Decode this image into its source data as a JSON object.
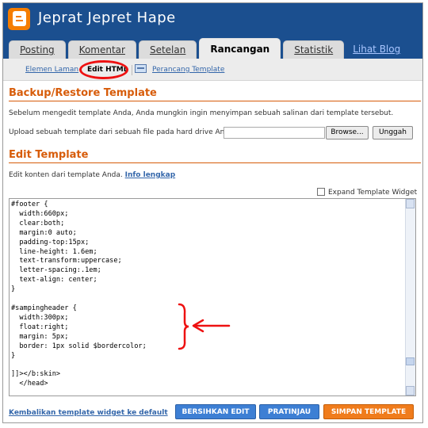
{
  "app": {
    "blog_title": "Jeprat Jepret Hape"
  },
  "tabs": [
    {
      "label": "Posting"
    },
    {
      "label": "Komentar"
    },
    {
      "label": "Setelan"
    },
    {
      "label": "Rancangan",
      "active": true
    },
    {
      "label": "Statistik"
    },
    {
      "label": "Lihat Blog"
    }
  ],
  "subnav": {
    "items": [
      {
        "label": "Elemen Laman"
      },
      {
        "label": "Edit HTML",
        "active": true
      },
      {
        "label": "Perancang Template"
      }
    ]
  },
  "backup": {
    "heading": "Backup/Restore Template",
    "description": "Sebelum mengedit template Anda, Anda mungkin ingin menyimpan sebuah salinan dari template tersebut.",
    "upload_label": "Upload sebuah template dari sebuah file pada hard drive Anda:",
    "upload_value": "",
    "browse_label": "Browse...",
    "upload_button": "Unggah"
  },
  "edit_template": {
    "heading": "Edit Template",
    "description": "Edit konten dari template Anda.",
    "info_link": "Info lengkap",
    "expand_label": "Expand Template Widget",
    "expand_checked": false,
    "code": "#footer {\n  width:660px;\n  clear:both;\n  margin:0 auto;\n  padding-top:15px;\n  line-height: 1.6em;\n  text-transform:uppercase;\n  letter-spacing:.1em;\n  text-align: center;\n}\n\n#sampingheader {\n  width:300px;\n  float:right;\n  margin: 5px;\n  border: 1px solid $bordercolor;\n}\n\n]]></b:skin>\n  </head>"
  },
  "footer": {
    "revert_link": "Kembalikan template widget ke default",
    "clear_button": "BERSIHKAN EDIT",
    "preview_button": "PRATINJAU",
    "save_button": "SIMPAN TEMPLATE"
  },
  "colors": {
    "header_bg": "#1b4f8f",
    "accent_orange": "#d75c0a",
    "annotation_red": "#ee1111",
    "button_blue": "#3d7fd4",
    "button_orange": "#f07c1c"
  }
}
